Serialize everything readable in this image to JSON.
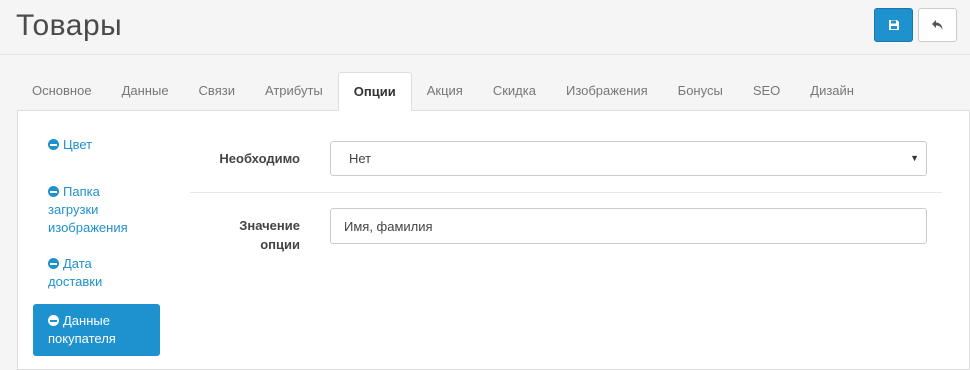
{
  "page": {
    "title": "Товары"
  },
  "header": {
    "save_icon": "save-icon",
    "back_icon": "reply-icon",
    "accent_color": "#1e91cf"
  },
  "tabs": [
    {
      "label": "Основное",
      "active": false
    },
    {
      "label": "Данные",
      "active": false
    },
    {
      "label": "Связи",
      "active": false
    },
    {
      "label": "Атрибуты",
      "active": false
    },
    {
      "label": "Опции",
      "active": true
    },
    {
      "label": "Акция",
      "active": false
    },
    {
      "label": "Скидка",
      "active": false
    },
    {
      "label": "Изображения",
      "active": false
    },
    {
      "label": "Бонусы",
      "active": false
    },
    {
      "label": "SEO",
      "active": false
    },
    {
      "label": "Дизайн",
      "active": false
    }
  ],
  "options": [
    {
      "label": "Цвет",
      "icon": "minus-circle-icon",
      "active": false
    },
    {
      "label": "Папка загрузки изображения",
      "icon": "minus-circle-icon",
      "active": false
    },
    {
      "label": "Дата доставки",
      "icon": "minus-circle-icon",
      "active": false
    },
    {
      "label": "Данные покупателя",
      "icon": "minus-circle-icon",
      "active": true
    }
  ],
  "form": {
    "required": {
      "label": "Необходимо",
      "value": "Нет"
    },
    "option_value": {
      "label": "Значение опции",
      "value": "Имя, фамилия"
    }
  }
}
